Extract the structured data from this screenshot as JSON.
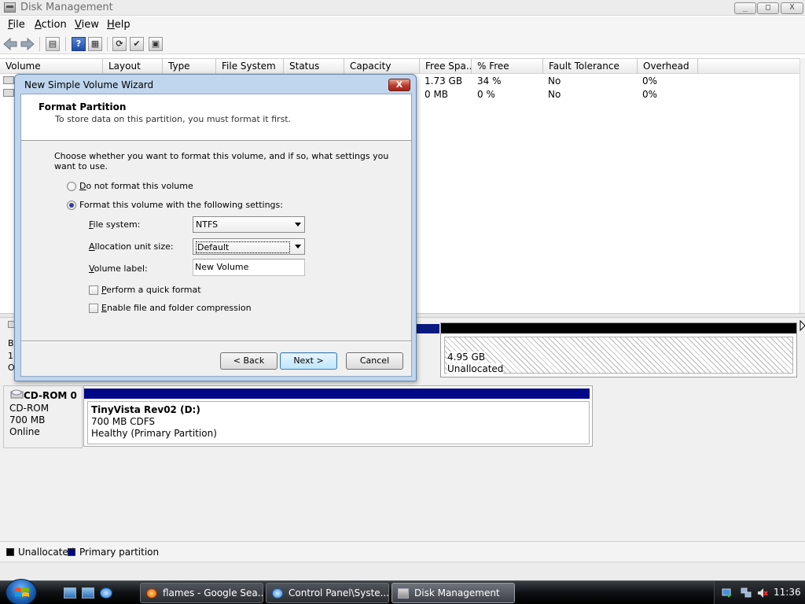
{
  "window": {
    "title": "Disk Management",
    "minimize": "_",
    "maximize": "□",
    "close": "X"
  },
  "menubar": [
    "File",
    "Action",
    "View",
    "Help"
  ],
  "toolbar": {
    "icons": [
      "back-arrow-icon",
      "forward-arrow-icon",
      "console-tree-icon",
      "help-icon",
      "properties-icon",
      "refresh-icon",
      "settings-icon",
      "console-icon"
    ]
  },
  "volume_list": {
    "columns": [
      "Volume",
      "Layout",
      "Type",
      "File System",
      "Status",
      "Capacity",
      "Free Spa...",
      "% Free",
      "Fault Tolerance",
      "Overhead"
    ],
    "rows": [
      {
        "free_space": "1.73 GB",
        "pct_free": "34 %",
        "fault_tolerance": "No",
        "overhead": "0%"
      },
      {
        "free_space": "0 MB",
        "pct_free": "0 %",
        "fault_tolerance": "No",
        "overhead": "0%"
      }
    ]
  },
  "disk0": {
    "label_fragments": [
      "B",
      "1(",
      "O"
    ],
    "unallocated": {
      "size": "4.95 GB",
      "label": "Unallocated"
    }
  },
  "cdrom0": {
    "title": "CD-ROM 0",
    "type": "CD-ROM",
    "size": "700 MB",
    "status": "Online",
    "partition": {
      "name": "TinyVista Rev02  (D:)",
      "info": "700 MB CDFS",
      "health": "Healthy (Primary Partition)"
    }
  },
  "legend": [
    {
      "label": "Unallocated",
      "color": "#000000"
    },
    {
      "label": "Primary partition",
      "color": "#000888"
    }
  ],
  "wizard": {
    "title": "New Simple Volume Wizard",
    "close": "X",
    "header_title": "Format Partition",
    "header_subtitle": "To store data on this partition, you must format it first.",
    "intro": "Choose whether you want to format this volume, and if so, what settings you want to use.",
    "option_no_format": "Do not format this volume",
    "option_format": "Format this volume with the following settings:",
    "selected_option": "format",
    "file_system_label": "File system:",
    "file_system_value": "NTFS",
    "allocation_label": "Allocation unit size:",
    "allocation_value": "Default",
    "volume_label_label": "Volume label:",
    "volume_label_value": "New Volume",
    "quick_format_label": "Perform a quick format",
    "quick_format_checked": false,
    "compression_label": "Enable file and folder compression",
    "compression_checked": false,
    "back_button": "< Back",
    "next_button": "Next >",
    "cancel_button": "Cancel"
  },
  "taskbar": {
    "tasks": [
      "flames - Google Sea...",
      "Control Panel\\Syste...",
      "Disk Management"
    ],
    "active_task": "Disk Management",
    "clock": "11:36"
  }
}
